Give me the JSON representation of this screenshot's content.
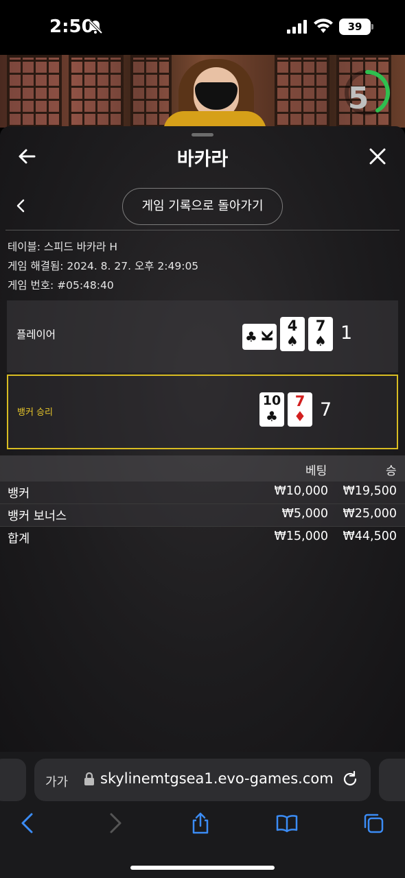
{
  "status_bar": {
    "time": "2:50",
    "battery": "39"
  },
  "video": {
    "countdown": "5"
  },
  "panel": {
    "title": "바카라",
    "history_button": "게임 기록으로 돌아가기",
    "table_info": "테이블: 스피드 바카라 H",
    "resolved": "게임 해결됨: 2024. 8. 27. 오후 2:49:05",
    "game_number": "게임 번호: #05:48:40"
  },
  "player": {
    "label": "플레이어",
    "score": "1",
    "cards": [
      {
        "rank": "K",
        "suit": "♣",
        "color": "black",
        "rotated": true
      },
      {
        "rank": "4",
        "suit": "♠",
        "color": "black"
      },
      {
        "rank": "7",
        "suit": "♠",
        "color": "black"
      }
    ]
  },
  "banker": {
    "label": "뱅커 승리",
    "score": "7",
    "cards": [
      {
        "rank": "10",
        "suit": "♣",
        "color": "black"
      },
      {
        "rank": "7",
        "suit": "♦",
        "color": "red"
      }
    ]
  },
  "bets": {
    "headers": {
      "bet": "베팅",
      "win": "승"
    },
    "rows": [
      {
        "name": "뱅커",
        "bet": "₩10,000",
        "win": "₩19,500"
      },
      {
        "name": "뱅커 보너스",
        "bet": "₩5,000",
        "win": "₩25,000"
      }
    ],
    "total": {
      "name": "합계",
      "bet": "₩15,000",
      "win": "₩44,500"
    }
  },
  "browser": {
    "text_size": "가가",
    "url": "skylinemtgsea1.evo-games.com"
  },
  "colors": {
    "banker_highlight": "#d9bd22",
    "safari_blue": "#3b8cf5",
    "timer_green": "#2fbf4f"
  },
  "icons": [
    "bell-off-icon",
    "signal-icon",
    "wifi-icon",
    "back-arrow-icon",
    "close-icon",
    "chevron-left-icon",
    "lock-icon",
    "reload-icon",
    "share-icon",
    "bookmarks-icon",
    "tabs-icon"
  ]
}
